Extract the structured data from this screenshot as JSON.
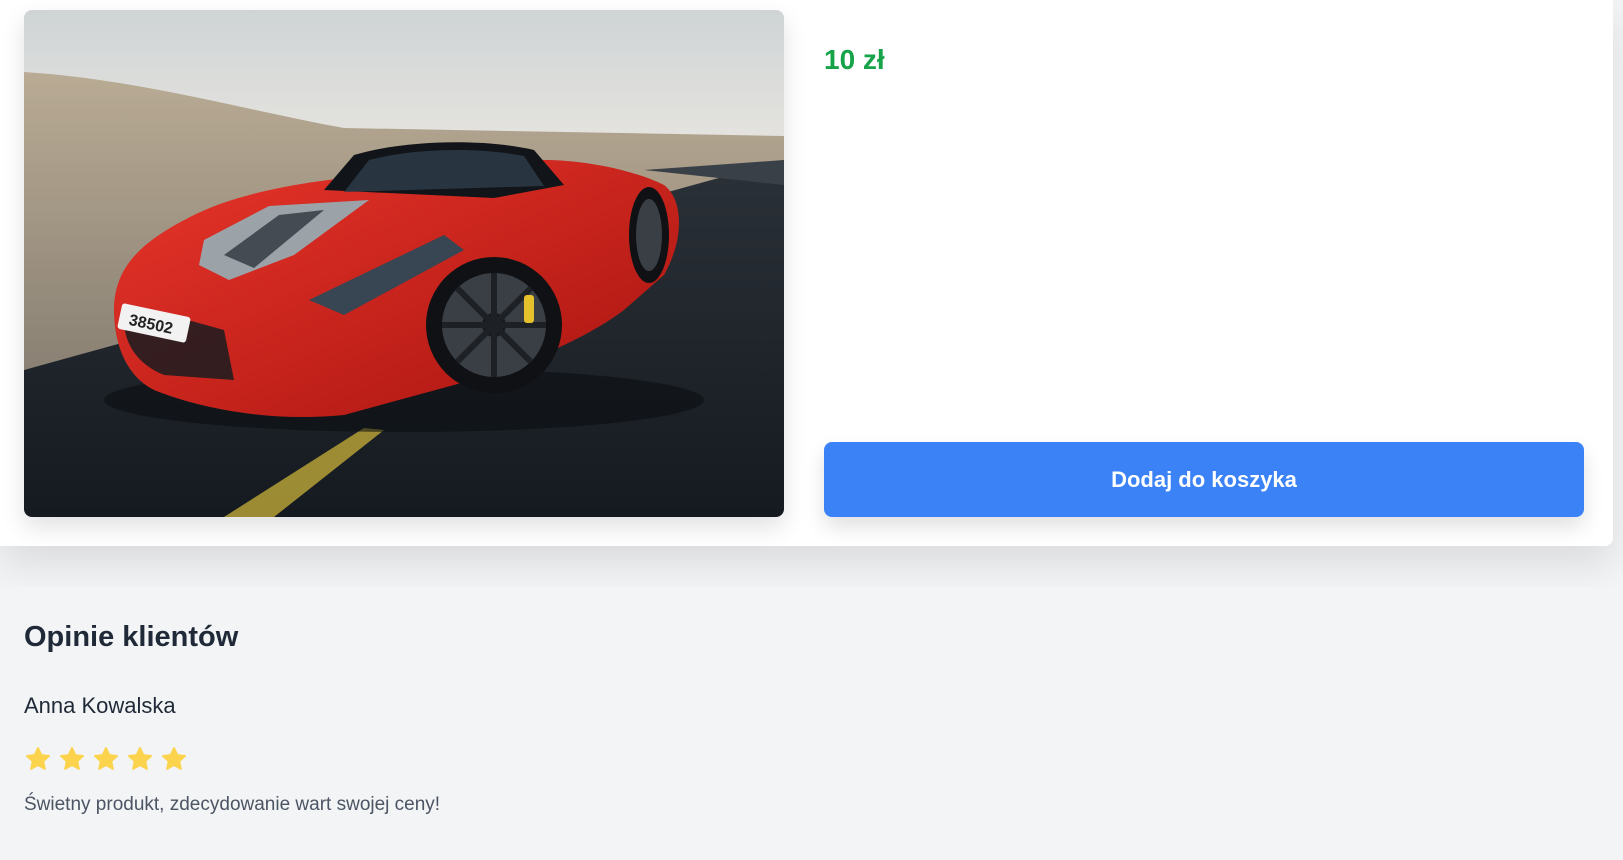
{
  "product": {
    "image_alt": "Czerwony samochód sportowy na pustynnej drodze",
    "price": "10 zł",
    "add_to_cart_label": "Dodaj do koszyka",
    "plate_text": "38502"
  },
  "reviews": {
    "title": "Opinie klientów",
    "items": [
      {
        "author": "Anna Kowalska",
        "rating": 5,
        "max_rating": 5,
        "text": "Świetny produkt, zdecydowanie wart swojej ceny!"
      }
    ]
  },
  "colors": {
    "price": "#16a34a",
    "button": "#3b82f6",
    "star": "#fcd34d"
  }
}
